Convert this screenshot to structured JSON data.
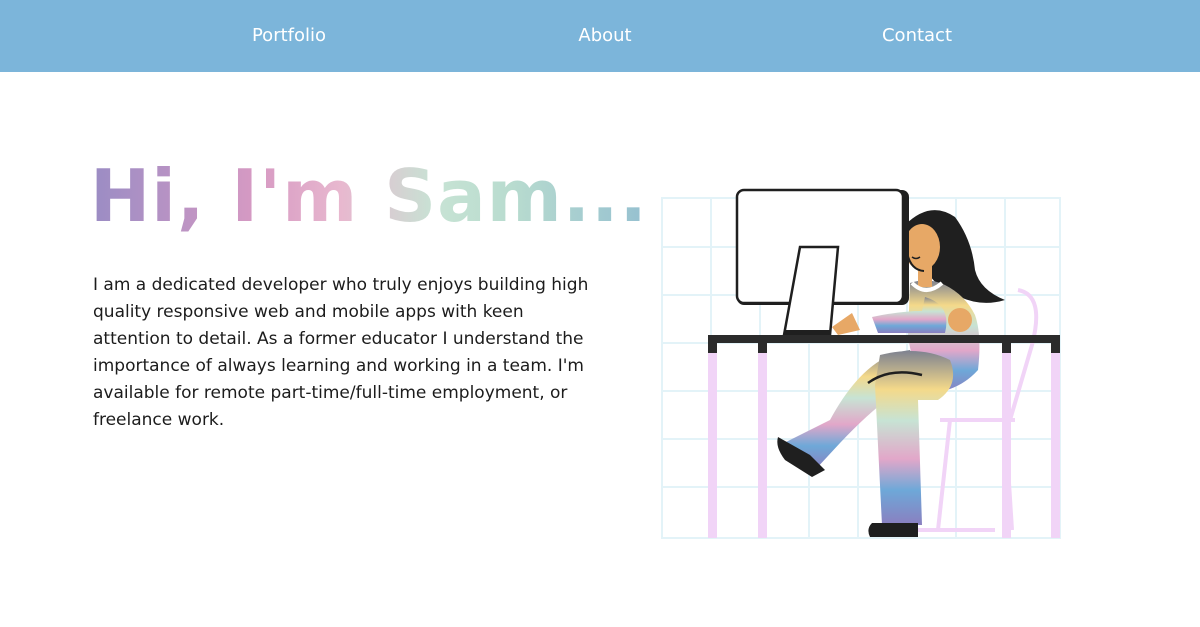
{
  "nav": {
    "items": [
      {
        "label": "Portfolio"
      },
      {
        "label": "About"
      },
      {
        "label": "Contact"
      }
    ]
  },
  "hero": {
    "title": "Hi, I'm Sam...",
    "bio": "I am a dedicated developer who truly enjoys building high quality responsive web and mobile apps with keen attention to detail. As a former educator I understand the importance of always learning and working in a team. I'm available for remote part-time/full-time employment, or freelance work."
  },
  "colors": {
    "nav_background": "#7cb5da",
    "nav_text": "#ffffff",
    "body_text": "#1c1c1c",
    "title_gradient": [
      "#9a8cc4",
      "#d79ac3",
      "#c7e3d4",
      "#95c0d0"
    ],
    "grid_lines": "#e3f3f8",
    "desk_legs": "#f1d4f7",
    "desk_top": "#2b2b2b",
    "hair": "#1f1f1f",
    "skin": "#e7a866"
  },
  "icons": {
    "illustration": "developer-at-computer-illustration"
  }
}
